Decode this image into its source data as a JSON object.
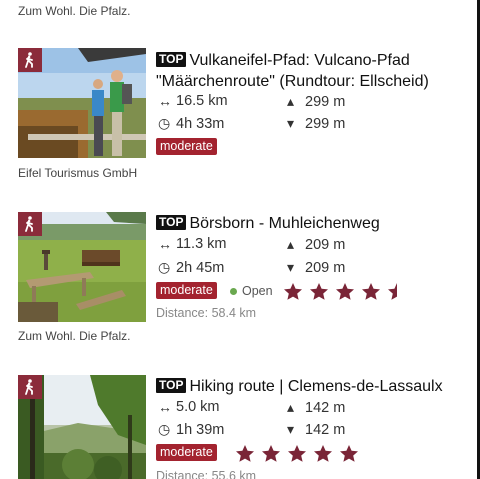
{
  "top_credit": "Zum Wohl. Die Pfalz.",
  "icons": {
    "type": "hiking-icon",
    "distance": "arrows-horizontal-icon",
    "duration": "clock-icon",
    "ascent": "triangle-up-icon",
    "descent": "triangle-down-icon"
  },
  "colors": {
    "badge": "#8b2b3a",
    "difficulty": "#a3232f",
    "star": "#7a2537",
    "open": "#6aa84f"
  },
  "cards": [
    {
      "top_label": "TOP",
      "title": "Vulkaneifel-Pfad: Vulcano-Pfad \"Määrchenroute\" (Rundtour: Ellscheid)",
      "distance": "16.5 km",
      "duration": "4h 33m",
      "ascent": "299 m",
      "descent": "299 m",
      "difficulty": "moderate",
      "credit": "Eifel Tourismus GmbH"
    },
    {
      "top_label": "TOP",
      "title": "Börsborn - Muhleichenweg",
      "distance": "11.3 km",
      "duration": "2h 45m",
      "ascent": "209 m",
      "descent": "209 m",
      "difficulty": "moderate",
      "status": "Open",
      "rating": 4.5,
      "distance_to": "Distance: 58.4 km",
      "credit": "Zum Wohl. Die Pfalz."
    },
    {
      "top_label": "TOP",
      "title": "Hiking route | Clemens-de-Lassaulx",
      "distance": "5.0 km",
      "duration": "1h 39m",
      "ascent": "142 m",
      "descent": "142 m",
      "difficulty": "moderate",
      "rating": 5,
      "distance_to": "Distance: 55.6 km"
    }
  ]
}
